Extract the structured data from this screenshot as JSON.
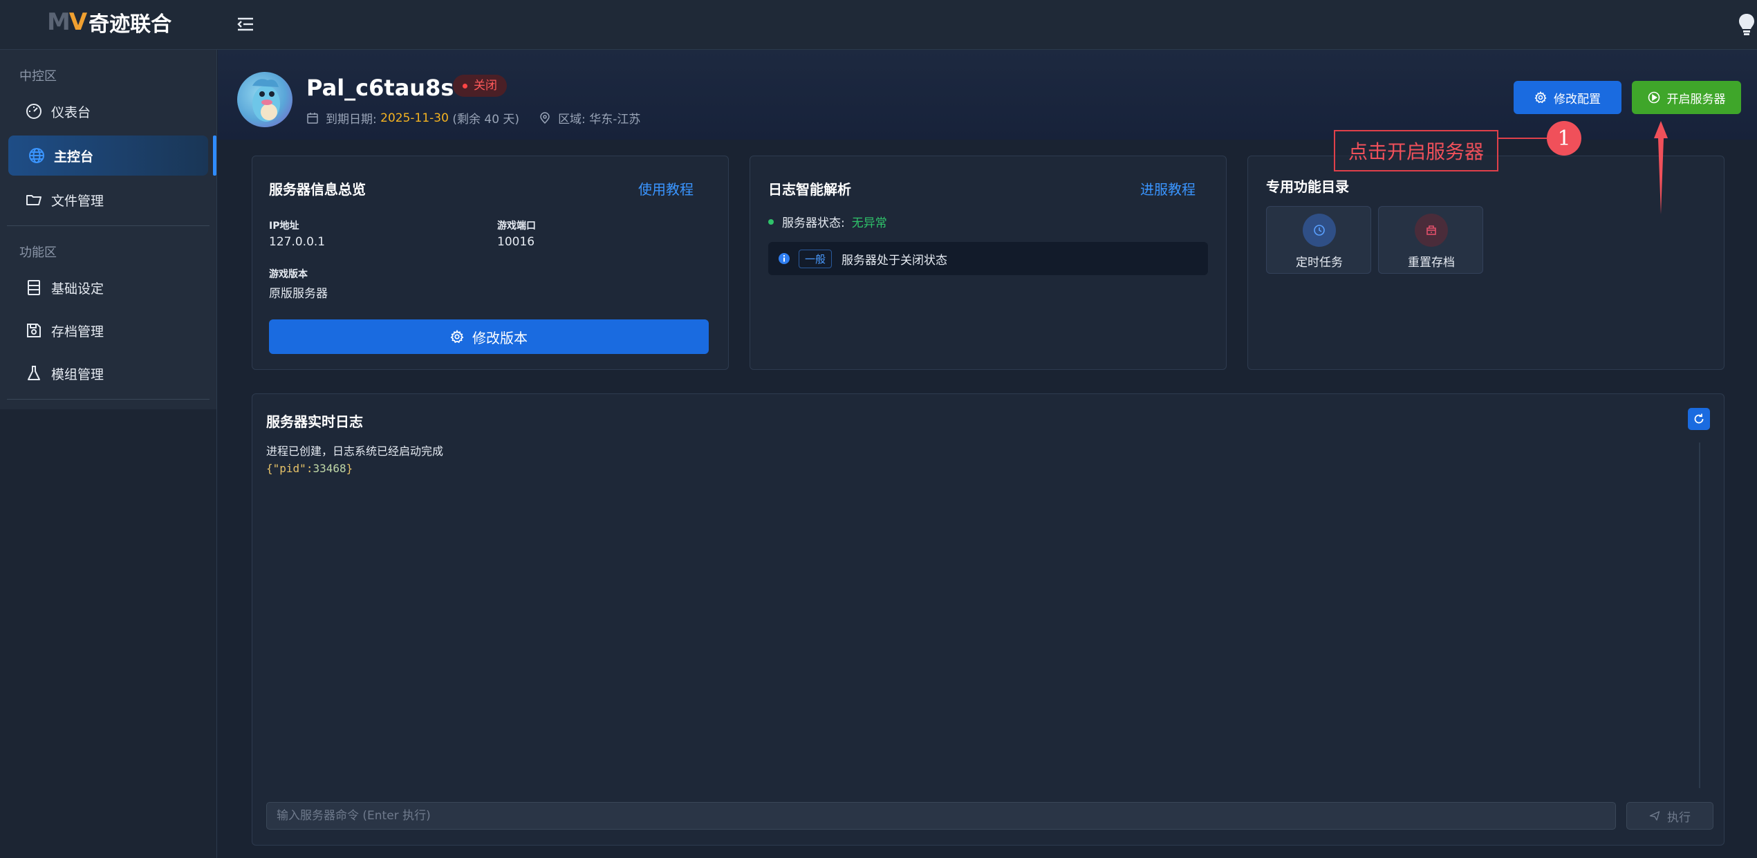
{
  "app": {
    "logo_mark_m": "M",
    "logo_mark_v": "V",
    "logo_text": "奇迹联合"
  },
  "sidebar": {
    "sections": [
      {
        "label": "中控区",
        "items": [
          {
            "label": "仪表台",
            "icon": "gauge-icon"
          },
          {
            "label": "主控台",
            "icon": "globe-icon",
            "active": true
          },
          {
            "label": "文件管理",
            "icon": "folder-icon"
          }
        ]
      },
      {
        "label": "功能区",
        "items": [
          {
            "label": "基础设定",
            "icon": "server-icon"
          },
          {
            "label": "存档管理",
            "icon": "save-icon"
          },
          {
            "label": "模组管理",
            "icon": "flask-icon"
          }
        ]
      }
    ]
  },
  "header": {
    "server_name": "Pal_c6tau8s6o",
    "status": "关闭",
    "expire_label": "到期日期:",
    "expire_date": "2025-11-30",
    "remaining": "(剩余 40 天)",
    "region": "区域: 华东-江苏",
    "config_button": "修改配置",
    "start_button": "开启服务器"
  },
  "server_info": {
    "title": "服务器信息总览",
    "tutorial_link": "使用教程",
    "ip_label": "IP地址",
    "ip_value": "127.0.0.1",
    "port_label": "游戏端口",
    "port_value": "10016",
    "version_label": "游戏版本",
    "version_value": "原版服务器",
    "version_button": "修改版本"
  },
  "log_analysis": {
    "title": "日志智能解析",
    "tutorial_link": "进服教程",
    "status_label": "服务器状态:",
    "status_value": "无异常",
    "entry_tag": "一般",
    "entry_text": "服务器处于关闭状态"
  },
  "functions": {
    "title": "专用功能目录",
    "tiles": [
      {
        "label": "定时任务",
        "icon": "clock-icon"
      },
      {
        "label": "重置存档",
        "icon": "reset-archive-icon"
      }
    ]
  },
  "console": {
    "title": "服务器实时日志",
    "line1": "进程已创建，日志系统已经启动完成",
    "line2_open": "{",
    "line2_key": "\"pid\"",
    "line2_colon": ":",
    "line2_value": "33468",
    "line2_close": "}",
    "input_placeholder": "输入服务器命令 (Enter 执行)",
    "exec_button": "执行"
  },
  "annotation": {
    "text": "点击开启服务器",
    "number": "1",
    "color": "#f0505a"
  },
  "colors": {
    "accent_blue": "#1a6be0",
    "start_green": "#3fa62a",
    "status_red": "#ff5a5a",
    "ok_green": "#2fc36a",
    "date_yellow": "#f5b321"
  }
}
